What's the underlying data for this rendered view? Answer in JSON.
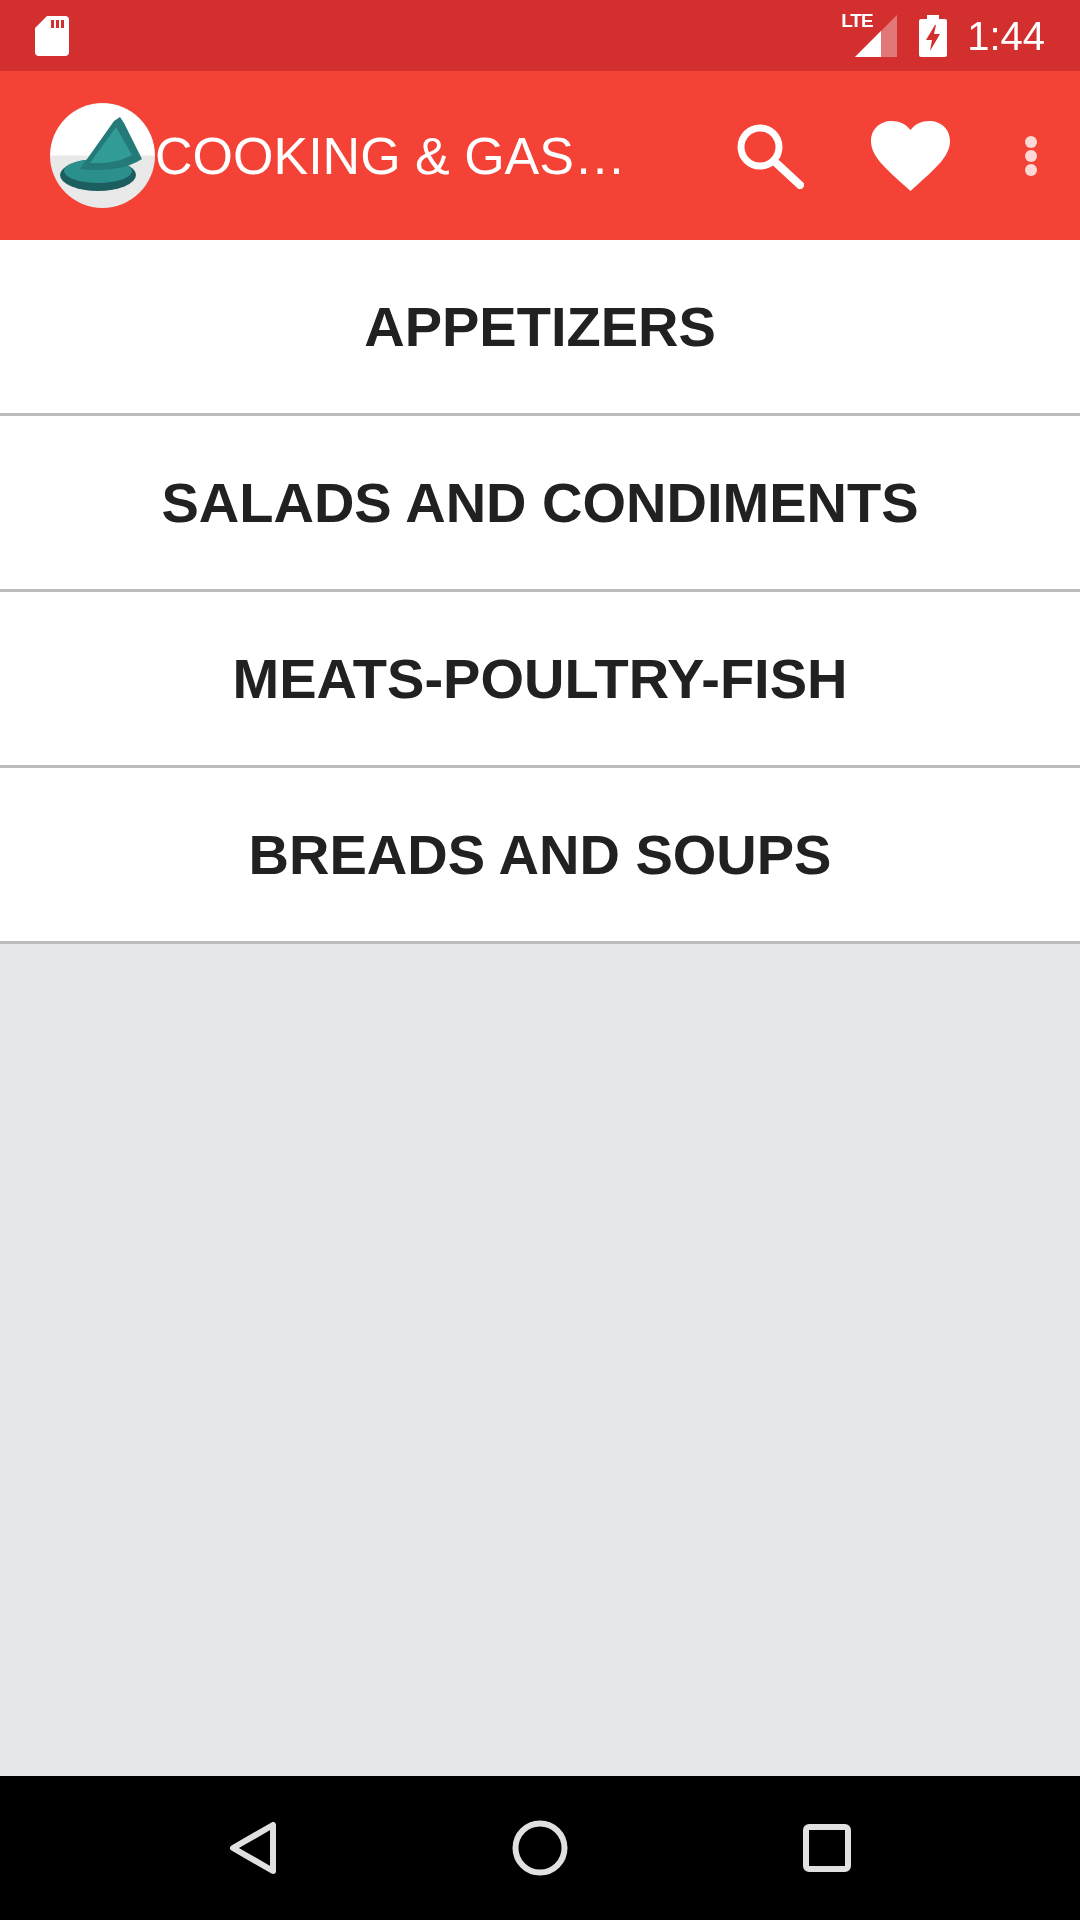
{
  "status_bar": {
    "network_type": "LTE",
    "time": "1:44"
  },
  "app_bar": {
    "title": "COOKING & GAS…"
  },
  "categories": [
    {
      "label": "APPETIZERS"
    },
    {
      "label": "SALADS AND CONDIMENTS"
    },
    {
      "label": "MEATS-POULTRY-FISH"
    },
    {
      "label": "BREADS AND SOUPS"
    }
  ]
}
